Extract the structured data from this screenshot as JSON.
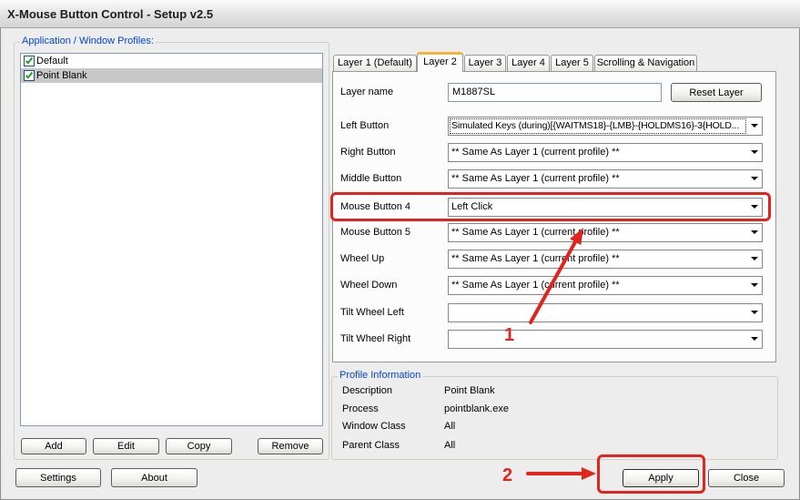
{
  "window": {
    "title": "X-Mouse Button Control - Setup v2.5"
  },
  "profiles": {
    "group_label": "Application / Window Profiles:",
    "items": [
      {
        "label": "Default",
        "checked": true,
        "selected": false
      },
      {
        "label": "Point Blank",
        "checked": true,
        "selected": true
      }
    ],
    "buttons": {
      "add": "Add",
      "edit": "Edit",
      "copy": "Copy",
      "remove": "Remove"
    }
  },
  "tabs": [
    {
      "label": "Layer 1 (Default)",
      "active": false
    },
    {
      "label": "Layer 2",
      "active": true
    },
    {
      "label": "Layer 3",
      "active": false
    },
    {
      "label": "Layer 4",
      "active": false
    },
    {
      "label": "Layer 5",
      "active": false
    },
    {
      "label": "Scrolling & Navigation",
      "active": false
    }
  ],
  "layer": {
    "name_label": "Layer name",
    "name_value": "M1887SL",
    "reset_button": "Reset Layer",
    "rows": [
      {
        "label": "Left Button",
        "value": "Simulated Keys (during)[{WAITMS18}-{LMB}-{HOLDMS16}-3{HOLD..."
      },
      {
        "label": "Right Button",
        "value": "** Same As Layer 1 (current profile) **"
      },
      {
        "label": "Middle Button",
        "value": "** Same As Layer 1 (current profile) **"
      },
      {
        "label": "Mouse Button 4",
        "value": "Left Click"
      },
      {
        "label": "Mouse Button 5",
        "value": "** Same As Layer 1 (current profile) **"
      },
      {
        "label": "Wheel Up",
        "value": "** Same As Layer 1 (current profile) **"
      },
      {
        "label": "Wheel Down",
        "value": "** Same As Layer 1 (current profile) **"
      },
      {
        "label": "Tilt Wheel Left",
        "value": ""
      },
      {
        "label": "Tilt Wheel Right",
        "value": ""
      }
    ]
  },
  "profile_info": {
    "group_label": "Profile Information",
    "rows": [
      {
        "label": "Description",
        "value": "Point Blank"
      },
      {
        "label": "Process",
        "value": "pointblank.exe"
      },
      {
        "label": "Window Class",
        "value": "All"
      },
      {
        "label": "Parent Class",
        "value": "All"
      }
    ]
  },
  "footer": {
    "settings": "Settings",
    "about": "About",
    "apply": "Apply",
    "close": "Close"
  },
  "annotations": {
    "step_1": "1",
    "step_2": "2"
  },
  "icons": {
    "dropdown": "dropdown-arrow-icon",
    "checkbox": "checkmark-icon"
  },
  "colors": {
    "annotation": "#e3241d",
    "group_label": "#0046d5",
    "list_selection": "#c8c8c8",
    "active_tab_accent": "#f5b43c"
  }
}
